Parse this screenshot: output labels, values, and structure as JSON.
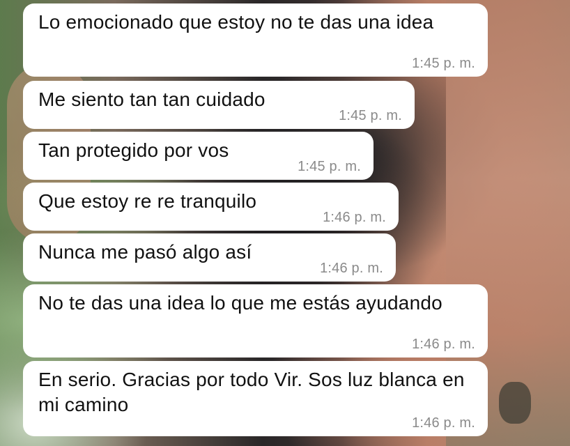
{
  "messages": [
    {
      "text": "Lo emocionado que estoy no te das una idea",
      "time": "1:45 p. m."
    },
    {
      "text": "Me siento tan tan cuidado",
      "time": "1:45 p. m."
    },
    {
      "text": "Tan protegido por vos",
      "time": "1:45 p. m."
    },
    {
      "text": "Que estoy re re tranquilo",
      "time": "1:46 p. m."
    },
    {
      "text": "Nunca me pasó algo así",
      "time": "1:46 p. m."
    },
    {
      "text": "No te das una idea lo que me estás ayudando",
      "time": "1:46 p. m."
    },
    {
      "text": "En serio. Gracias por todo Vir. Sos luz blanca en mi camino",
      "time": "1:46 p. m."
    }
  ],
  "colors": {
    "bubble_background": "#ffffff",
    "message_text": "#111111",
    "timestamp_text": "#8a8a8a"
  }
}
